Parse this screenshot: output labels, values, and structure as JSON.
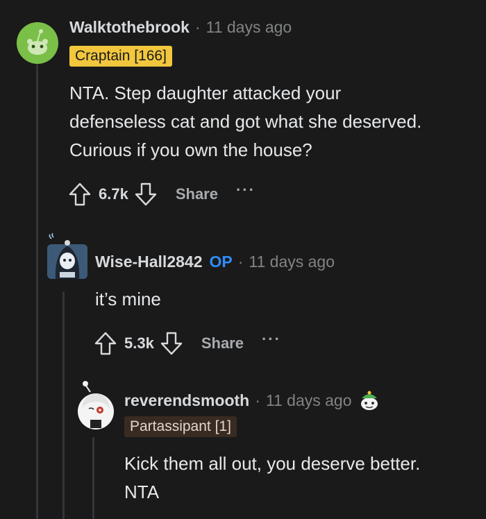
{
  "comments": [
    {
      "username": "Walktothebrook",
      "time": "11 days ago",
      "flair": "Craptain [166]",
      "body_lines": [
        "NTA. Step daughter attacked your",
        "defenseless cat and got what she deserved.",
        "Curious if you own the house?"
      ],
      "score": "6.7k",
      "share_label": "Share",
      "more_label": "···"
    },
    {
      "username": "Wise-Hall2842",
      "op_tag": "OP",
      "time": "11 days ago",
      "body_lines": [
        "it’s mine"
      ],
      "score": "5.3k",
      "share_label": "Share",
      "more_label": "···"
    },
    {
      "username": "reverendsmooth",
      "time": "11 days ago",
      "flair": "Partassipant [1]",
      "body_lines": [
        "Kick them all out, you deserve better.",
        "NTA"
      ]
    }
  ],
  "separator": "·",
  "icons": {
    "upvote": "upvote-arrow-icon",
    "downvote": "downvote-arrow-icon",
    "award": "award-icon"
  },
  "colors": {
    "background": "#1a1a1b",
    "op": "#2f8cf6",
    "flair_gold": "#f2c73d",
    "flair_brown": "#3a2b22"
  }
}
